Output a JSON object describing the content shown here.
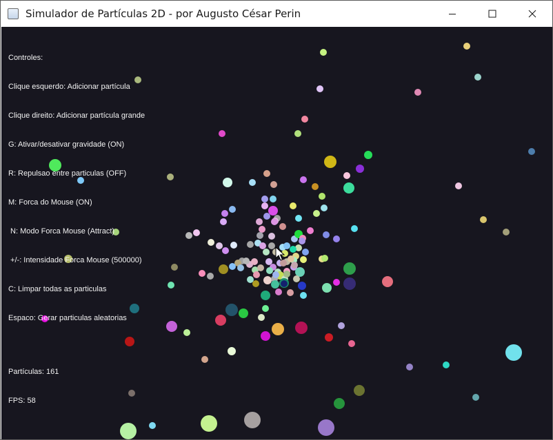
{
  "window": {
    "title": "Simulador de Partículas 2D - por Augusto César Perin",
    "controls": [
      "minimize-icon",
      "maximize-icon",
      "close-icon"
    ]
  },
  "hud": {
    "controls_header": "Controles:",
    "lines": [
      "Clique esquerdo: Adicionar partícula",
      "Clique direito: Adicionar partícula grande",
      "G: Ativar/desativar gravidade (ON)",
      "R: Repulsao entre particulas (OFF)",
      "M: Forca do Mouse (ON)",
      " N: Modo Forca Mouse (Attract)",
      " +/-: Intensidade Forca Mouse (500000)",
      "C: Limpar todas as particulas",
      "Espaco: Gerar particulas aleatorias"
    ],
    "particles_count": "Partículas: 161",
    "fps": "FPS: 58"
  },
  "scene": {
    "background": "#17161f",
    "cursor": "arrow-cursor-icon",
    "particles": [
      [
        "#c5f281",
        467,
        37,
        5
      ],
      [
        "#e9d07a",
        675,
        28,
        5
      ],
      [
        "#9cd4cc",
        691,
        73,
        5
      ],
      [
        "#e0c4f7",
        462,
        90,
        5
      ],
      [
        "#e089b4",
        604,
        95,
        5
      ],
      [
        "#a9b87d",
        198,
        77,
        5
      ],
      [
        "#f287a0",
        440,
        134,
        5
      ],
      [
        "#b1e07c",
        430,
        155,
        5
      ],
      [
        "#e14aca",
        320,
        155,
        5
      ],
      [
        "#4d7dab",
        769,
        181,
        5
      ],
      [
        "#26dd59",
        532,
        186,
        6
      ],
      [
        "#4fea5c",
        78,
        201,
        9
      ],
      [
        "#d0b716",
        477,
        196,
        9
      ],
      [
        "#8a2fd8",
        520,
        206,
        6
      ],
      [
        "#f8c6dd",
        501,
        216,
        5
      ],
      [
        "#7ec8f7",
        115,
        223,
        5
      ],
      [
        "#aab07c",
        245,
        218,
        5
      ],
      [
        "#d2f8ea",
        328,
        226,
        7
      ],
      [
        "#a7dff7",
        364,
        226,
        5
      ],
      [
        "#d6a08a",
        385,
        213,
        5
      ],
      [
        "#d1a094",
        395,
        229,
        5
      ],
      [
        "#ca74ee",
        438,
        222,
        5
      ],
      [
        "#c99123",
        455,
        232,
        5
      ],
      [
        "#3cdc9c",
        504,
        234,
        8
      ],
      [
        "#efc6e1",
        663,
        231,
        5
      ],
      [
        "#82d4ef",
        394,
        250,
        5
      ],
      [
        "#a39dee",
        382,
        250,
        5
      ],
      [
        "#b1e46c",
        465,
        246,
        5
      ],
      [
        "#e6b1f1",
        382,
        260,
        5
      ],
      [
        "#9ee3ee",
        468,
        263,
        5
      ],
      [
        "#8ab9f0",
        335,
        265,
        5
      ],
      [
        "#c481ee",
        324,
        271,
        5
      ],
      [
        "#e9e96c",
        423,
        260,
        5
      ],
      [
        "#c7f18b",
        457,
        271,
        5
      ],
      [
        "#d94ee8",
        394,
        267,
        7
      ],
      [
        "#9d95ea",
        385,
        275,
        5
      ],
      [
        "#a2a2a2",
        400,
        278,
        5
      ],
      [
        "#72e6f5",
        431,
        278,
        5
      ],
      [
        "#d8aaf5",
        322,
        283,
        5
      ],
      [
        "#dda8d5",
        374,
        283,
        5
      ],
      [
        "#e6c2e1",
        397,
        282,
        5
      ],
      [
        "#dd95e3",
        396,
        283,
        5
      ],
      [
        "#d09090",
        408,
        290,
        5
      ],
      [
        "#ef7ed0",
        448,
        296,
        5
      ],
      [
        "#e89ac8",
        378,
        294,
        5
      ],
      [
        "#a3a3ac",
        375,
        303,
        5
      ],
      [
        "#a7c4f0",
        425,
        308,
        5
      ],
      [
        "#57e0f0",
        512,
        293,
        5
      ],
      [
        "#d9c56d",
        699,
        280,
        5
      ],
      [
        "#a39f79",
        732,
        298,
        5
      ],
      [
        "#a6d47a",
        166,
        298,
        5
      ],
      [
        "#b8b8b8",
        272,
        303,
        5
      ],
      [
        "#f1c6f0",
        283,
        299,
        5
      ],
      [
        "#dbc0df",
        392,
        304,
        5
      ],
      [
        "#1fdd3d",
        431,
        301,
        6
      ],
      [
        "#7f8ce6",
        471,
        302,
        5
      ],
      [
        "#9582ec",
        486,
        308,
        5
      ],
      [
        "#eeeed9",
        304,
        313,
        5
      ],
      [
        "#e0c7e8",
        316,
        318,
        5
      ],
      [
        "#cf8ff0",
        325,
        325,
        5
      ],
      [
        "#e0eafb",
        337,
        317,
        5
      ],
      [
        "#a6a6a6",
        361,
        316,
        5
      ],
      [
        "#acdff0",
        372,
        314,
        5
      ],
      [
        "#dba4e5",
        379,
        318,
        5
      ],
      [
        "#b6e7c3",
        384,
        327,
        5
      ],
      [
        "#a8a8a8",
        392,
        318,
        5
      ],
      [
        "#c7c0a7",
        398,
        327,
        5
      ],
      [
        "#a4dff7",
        408,
        320,
        5
      ],
      [
        "#d8e96d",
        411,
        329,
        5
      ],
      [
        "#82c2f4",
        414,
        318,
        5
      ],
      [
        "#c8e0b0",
        431,
        321,
        5
      ],
      [
        "#7ea3ee",
        441,
        327,
        5
      ],
      [
        "#ee8ac0",
        437,
        307,
        5
      ],
      [
        "#aa96e9",
        436,
        311,
        5
      ],
      [
        "#e2d78a",
        427,
        333,
        5
      ],
      [
        "#e6f07a",
        438,
        338,
        5
      ],
      [
        "#e8dd8c",
        465,
        337,
        5
      ],
      [
        "#b2e870",
        469,
        336,
        5
      ],
      [
        "#bfb9a6",
        414,
        341,
        5
      ],
      [
        "#a7f2c5",
        424,
        339,
        5
      ],
      [
        "#a0a0a0",
        349,
        340,
        5
      ],
      [
        "#b7a87a",
        343,
        343,
        5
      ],
      [
        "#ddb3ce",
        360,
        345,
        5
      ],
      [
        "#b7b7b7",
        355,
        340,
        5
      ],
      [
        "#e8b1c5",
        367,
        341,
        5
      ],
      [
        "#d6b8f0",
        388,
        341,
        5
      ],
      [
        "#c78ce1",
        394,
        349,
        5
      ],
      [
        "#c5b2f0",
        404,
        343,
        5
      ],
      [
        "#c29b9b",
        409,
        343,
        5
      ],
      [
        "#e1c5a0",
        420,
        337,
        5
      ],
      [
        "#1fdaa8",
        423,
        323,
        5
      ],
      [
        "#88c2f7",
        335,
        348,
        5
      ],
      [
        "#a08f22",
        322,
        352,
        7
      ],
      [
        "#95bfe2",
        347,
        350,
        5
      ],
      [
        "#a4e0ad",
        368,
        353,
        5
      ],
      [
        "#c6b4a4",
        376,
        350,
        5
      ],
      [
        "#8fe0c0",
        389,
        354,
        5
      ],
      [
        "#b3e2c4",
        401,
        356,
        5
      ],
      [
        "#f4a0c7",
        414,
        355,
        5
      ],
      [
        "#c7a0ee",
        424,
        349,
        5
      ],
      [
        "#c6a6b0",
        425,
        346,
        5
      ],
      [
        "#6ad0b6",
        433,
        356,
        7
      ],
      [
        "#2e9e4b",
        505,
        351,
        9
      ],
      [
        "#8e8a63",
        251,
        349,
        5
      ],
      [
        "#b6bd6b",
        97,
        337,
        6
      ],
      [
        "#f98eba",
        291,
        358,
        5
      ],
      [
        "#a9a9a9",
        303,
        362,
        5
      ],
      [
        "#9fe2d0",
        361,
        367,
        5
      ],
      [
        "#e89ab1",
        370,
        360,
        5
      ],
      [
        "#ecd1cd",
        386,
        368,
        6
      ],
      [
        "#c5dd58",
        404,
        361,
        6
      ],
      [
        "#b0b0b0",
        396,
        366,
        5
      ],
      [
        "#9fb5ef",
        398,
        360,
        5
      ],
      [
        "#c4e1c5",
        411,
        366,
        5
      ],
      [
        "#a3ba88",
        414,
        359,
        5
      ],
      [
        "#c7c7b0",
        428,
        366,
        5
      ],
      [
        "#45c09c",
        397,
        374,
        6
      ],
      [
        "#1b8e6b",
        410,
        372,
        7
      ],
      [
        "#14206e",
        410,
        373,
        5
      ],
      [
        "#2639c8",
        436,
        376,
        6
      ],
      [
        "#d87ccb",
        402,
        385,
        5
      ],
      [
        "#d99fa3",
        419,
        386,
        5
      ],
      [
        "#6de1f0",
        438,
        390,
        5
      ],
      [
        "#e42ee5",
        486,
        371,
        5
      ],
      [
        "#7de0b0",
        472,
        379,
        7
      ],
      [
        "#362b75",
        505,
        373,
        9
      ],
      [
        "#e56e7d",
        560,
        370,
        8
      ],
      [
        "#1fab7a",
        383,
        390,
        7
      ],
      [
        "#6fe4b1",
        246,
        375,
        5
      ],
      [
        "#ae9b21",
        369,
        373,
        5
      ],
      [
        "#6ef094",
        383,
        409,
        5
      ],
      [
        "#1f6f7d",
        193,
        409,
        7
      ],
      [
        "#23536a",
        334,
        411,
        9
      ],
      [
        "#2ac843",
        351,
        416,
        7
      ],
      [
        "#dce9c7",
        377,
        422,
        5
      ],
      [
        "#d83d61",
        318,
        426,
        8
      ],
      [
        "#e50cdf",
        63,
        424,
        5
      ],
      [
        "#c462d9",
        247,
        435,
        8
      ],
      [
        "#bcf098",
        269,
        444,
        5
      ],
      [
        "#eaaf48",
        401,
        439,
        9
      ],
      [
        "#b31255",
        435,
        437,
        9
      ],
      [
        "#d214d2",
        383,
        449,
        7
      ],
      [
        "#b0a2dd",
        493,
        434,
        5
      ],
      [
        "#cb1c24",
        475,
        451,
        6
      ],
      [
        "#e86591",
        508,
        460,
        5
      ],
      [
        "#b81616",
        186,
        457,
        7
      ],
      [
        "#e9fad8",
        334,
        471,
        6
      ],
      [
        "#d3a58d",
        295,
        483,
        5
      ],
      [
        "#9482c6",
        592,
        494,
        5
      ],
      [
        "#2ed8c4",
        645,
        491,
        5
      ],
      [
        "#71e1ec",
        743,
        473,
        12
      ],
      [
        "#7b6f6a",
        189,
        532,
        5
      ],
      [
        "#6b7331",
        519,
        528,
        8
      ],
      [
        "#26943c",
        490,
        547,
        8
      ],
      [
        "#64a6ad",
        688,
        538,
        5
      ],
      [
        "#b6f1a4",
        184,
        587,
        12
      ],
      [
        "#7fdaf2",
        219,
        579,
        5
      ],
      [
        "#c4f190",
        301,
        576,
        12
      ],
      [
        "#a6a0a0",
        364,
        571,
        12
      ],
      [
        "#9877c9",
        471,
        582,
        12
      ]
    ]
  }
}
